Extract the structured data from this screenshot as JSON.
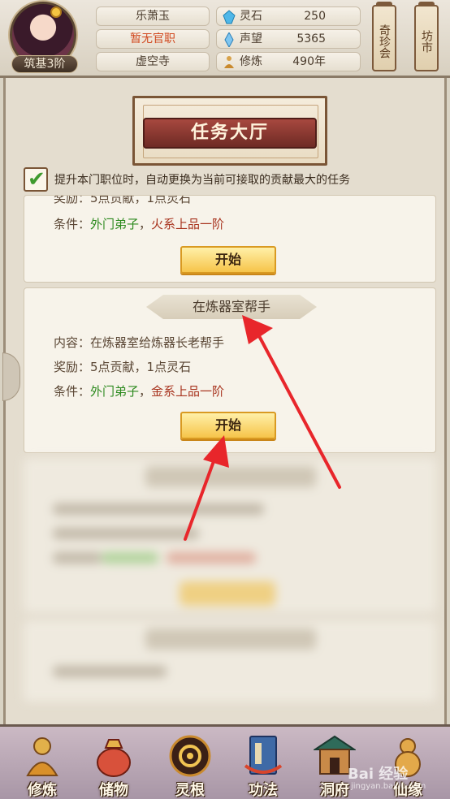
{
  "player": {
    "name": "乐萧玉",
    "official_title": "暂无官职",
    "sect": "虚空寺",
    "realm": "筑基3阶"
  },
  "stats": [
    {
      "label": "灵石",
      "value": "250",
      "icon": "spirit-stone-icon"
    },
    {
      "label": "声望",
      "value": "5365",
      "icon": "reputation-crystal-icon"
    },
    {
      "label": "修炼",
      "value": "490年",
      "icon": "meditation-icon"
    }
  ],
  "side_banners": {
    "treasure": "奇珍会",
    "market": "坊市"
  },
  "hall": {
    "title": "任务大厅",
    "auto_option": "提升本门职位时，自动更换为当前可接取的贡献最大的任务",
    "auto_checked": true
  },
  "tasks": [
    {
      "reward_label": "奖励：",
      "reward_text": "5点贡献，1点灵石",
      "condition_label": "条件：",
      "condition_rank": "外门弟子",
      "condition_sep": "，",
      "condition_req": "火系上品一阶",
      "button": "开始"
    },
    {
      "title": "在炼器室帮手",
      "content_label": "内容：",
      "content_text": "在炼器室给炼器长老帮手",
      "reward_label": "奖励：",
      "reward_text": "5点贡献，1点灵石",
      "condition_label": "条件：",
      "condition_rank": "外门弟子",
      "condition_sep": "，",
      "condition_req": "金系上品一阶",
      "button": "开始"
    }
  ],
  "bottom_nav": [
    {
      "label": "修炼",
      "icon": "cultivate-icon"
    },
    {
      "label": "储物",
      "icon": "storage-bag-icon"
    },
    {
      "label": "灵根",
      "icon": "spirit-root-icon"
    },
    {
      "label": "功法",
      "icon": "technique-book-icon"
    },
    {
      "label": "洞府",
      "icon": "cave-dwelling-icon"
    },
    {
      "label": "仙缘",
      "icon": "fate-gourd-icon"
    }
  ],
  "watermark": {
    "text": "Bai 经验",
    "sub": "jingyan.baidu.com"
  }
}
